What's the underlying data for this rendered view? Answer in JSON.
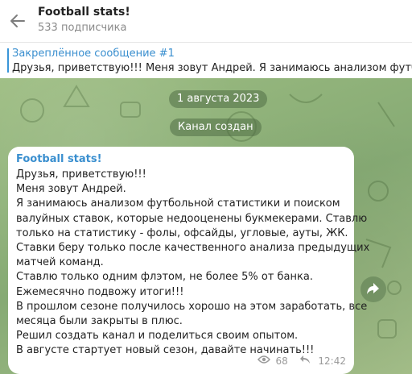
{
  "header": {
    "title": "Football stats!",
    "subscribers": "533 подписчика"
  },
  "pinned": {
    "label": "Закреплённое сообщение #1",
    "text": "Друзья, приветствую!!! Меня зовут Андрей. Я занимаюсь анализом футбольной"
  },
  "service": {
    "date": "1 августа 2023",
    "created": "Канал создан"
  },
  "message": {
    "sender": "Football stats!",
    "lines": [
      "Друзья, приветствую!!!",
      "Меня зовут Андрей.",
      "Я занимаюсь анализом футбольной статистики и поиском",
      "валуйных ставок, которые недооценены букмекерами. Ставлю",
      "только на статистику - фолы, офсайды, угловые, ауты, ЖК.",
      "Ставки беру только после качественного анализа предыдущих",
      "матчей команд.",
      "Ставлю только одним флэтом, не более 5% от банка.",
      "Ежемесячно подвожу итоги!!!",
      "В прошлом сезоне получилось хорошо на этом заработать, все",
      "месяца были закрыты в плюс.",
      "Решил создать канал и поделиться своим опытом.",
      "В августе стартует новый сезон, давайте начинать!!!"
    ],
    "views": "68",
    "time": "12:42"
  },
  "icons": {
    "back": "arrow-left-icon",
    "views": "eye-icon",
    "forward": "share-icon"
  },
  "colors": {
    "accent": "#3a8fcf",
    "background": "#8fb078"
  }
}
